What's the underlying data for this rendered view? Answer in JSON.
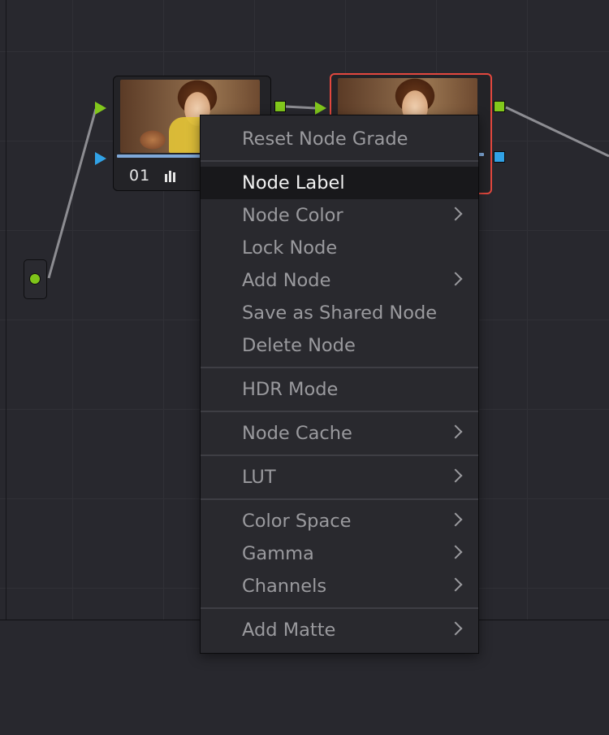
{
  "node_graph": {
    "nodes": [
      {
        "id": "node-1",
        "number": "01",
        "selected": false
      },
      {
        "id": "node-2",
        "selected": true
      }
    ],
    "colors": {
      "canvas_bg": "#28282e",
      "grid_line": "#303036",
      "rgb_port": "#82c81c",
      "alpha_port": "#31a2e6",
      "selected_outline": "#e2483e"
    }
  },
  "context_menu": {
    "items": [
      {
        "label": "Reset Node Grade",
        "submenu": false
      },
      {
        "label": "Node Label",
        "submenu": false,
        "highlighted": true
      },
      {
        "label": "Node Color",
        "submenu": true
      },
      {
        "label": "Lock Node",
        "submenu": false
      },
      {
        "label": "Add Node",
        "submenu": true
      },
      {
        "label": "Save as Shared Node",
        "submenu": false
      },
      {
        "label": "Delete Node",
        "submenu": false
      },
      {
        "label": "HDR Mode",
        "submenu": false
      },
      {
        "label": "Node Cache",
        "submenu": true
      },
      {
        "label": "LUT",
        "submenu": true
      },
      {
        "label": "Color Space",
        "submenu": true
      },
      {
        "label": "Gamma",
        "submenu": true
      },
      {
        "label": "Channels",
        "submenu": true
      },
      {
        "label": "Add Matte",
        "submenu": true
      }
    ],
    "colors": {
      "bg": "#29292e",
      "text": "#9a9a9e",
      "highlight_bg": "#18181b",
      "highlight_text": "#f2f2f2"
    }
  }
}
